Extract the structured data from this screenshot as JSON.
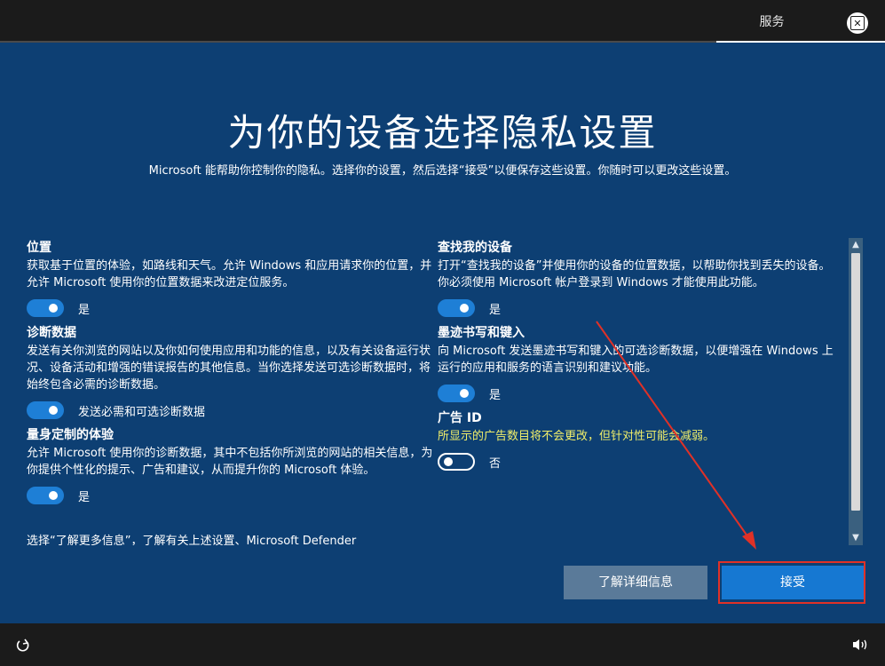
{
  "header": {
    "services_tab": "服务",
    "accessibility_icon": "accessibility-icon"
  },
  "main": {
    "title": "为你的设备选择隐私设置",
    "subtitle": "Microsoft 能帮助你控制你的隐私。选择你的设置，然后选择“接受”以便保存这些设置。你随时可以更改这些设置。"
  },
  "settings_left": [
    {
      "title": "位置",
      "description": "获取基于位置的体验，如路线和天气。允许 Windows 和应用请求你的位置，并允许 Microsoft 使用你的位置数据来改进定位服务。",
      "toggle_on": true,
      "toggle_label": "是"
    },
    {
      "title": "诊断数据",
      "description": "发送有关你浏览的网站以及你如何使用应用和功能的信息，以及有关设备运行状况、设备活动和增强的错误报告的其他信息。当你选择发送可选诊断数据时，将始终包含必需的诊断数据。",
      "toggle_on": true,
      "toggle_label": "发送必需和可选诊断数据"
    },
    {
      "title": "量身定制的体验",
      "description": "允许 Microsoft 使用你的诊断数据，其中不包括你所浏览的网站的相关信息，为你提供个性化的提示、广告和建议，从而提升你的 Microsoft 体验。",
      "toggle_on": true,
      "toggle_label": "是"
    }
  ],
  "settings_left_clipped": "选择“了解更多信息”，了解有关上述设置、Microsoft Defender",
  "settings_right": [
    {
      "title": "查找我的设备",
      "description": "打开“查找我的设备”并使用你的设备的位置数据，以帮助你找到丢失的设备。你必须使用 Microsoft 帐户登录到 Windows 才能使用此功能。",
      "toggle_on": true,
      "toggle_label": "是"
    },
    {
      "title": "墨迹书写和键入",
      "description": "向 Microsoft 发送墨迹书写和键入的可选诊断数据，以便增强在 Windows 上运行的应用和服务的语言识别和建议功能。",
      "toggle_on": true,
      "toggle_label": "是"
    },
    {
      "title": "广告 ID",
      "description": "所显示的广告数目将不会更改，但针对性可能会减弱。",
      "toggle_on": false,
      "toggle_label": "否"
    }
  ],
  "buttons": {
    "learn_more": "了解详细信息",
    "accept": "接受"
  },
  "footer": {
    "left_icon": "ease-of-access-icon",
    "right_icon": "volume-icon"
  },
  "colors": {
    "background": "#0d3f73",
    "accent": "#1678d2",
    "annotation": "#e03127",
    "warning_text": "#f0ee6a"
  }
}
